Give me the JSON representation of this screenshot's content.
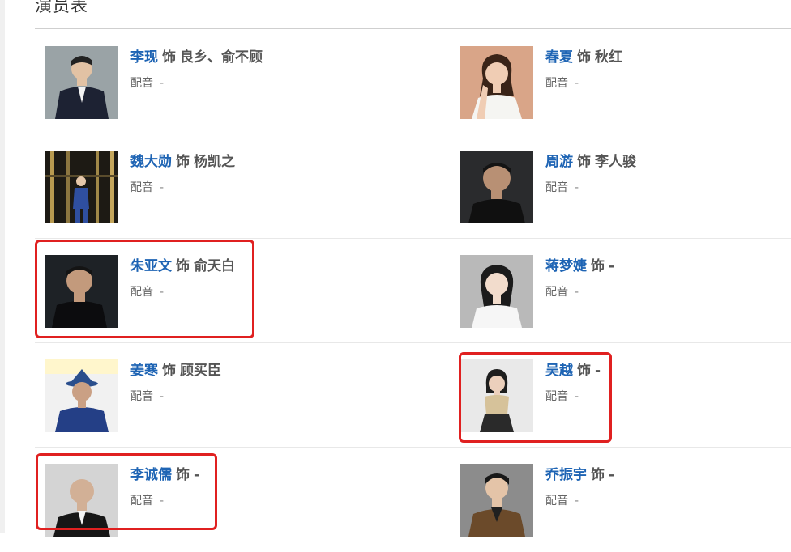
{
  "section": {
    "title": "演员表"
  },
  "cast": [
    {
      "actor": "李现",
      "role_prefix": "饰",
      "role": "良乡、俞不顾",
      "voice_label": "配音",
      "voice_value": "-"
    },
    {
      "actor": "春夏",
      "role_prefix": "饰",
      "role": "秋红",
      "voice_label": "配音",
      "voice_value": "-"
    },
    {
      "actor": "魏大勋",
      "role_prefix": "饰",
      "role": "杨凯之",
      "voice_label": "配音",
      "voice_value": "-"
    },
    {
      "actor": "周游",
      "role_prefix": "饰",
      "role": "李人骏",
      "voice_label": "配音",
      "voice_value": "-"
    },
    {
      "actor": "朱亚文",
      "role_prefix": "饰",
      "role": "俞天白",
      "voice_label": "配音",
      "voice_value": "-"
    },
    {
      "actor": "蒋梦婕",
      "role_prefix": "饰",
      "role": "-",
      "voice_label": "配音",
      "voice_value": "-"
    },
    {
      "actor": "姜寒",
      "role_prefix": "饰",
      "role": "顾买臣",
      "voice_label": "配音",
      "voice_value": "-"
    },
    {
      "actor": "吴越",
      "role_prefix": "饰",
      "role": "-",
      "voice_label": "配音",
      "voice_value": "-"
    },
    {
      "actor": "李诚儒",
      "role_prefix": "饰",
      "role": "-",
      "voice_label": "配音",
      "voice_value": "-"
    },
    {
      "actor": "乔振宇",
      "role_prefix": "饰",
      "role": "-",
      "voice_label": "配音",
      "voice_value": "-"
    }
  ],
  "colors": {
    "actor_link": "#1e64b4",
    "highlight": "#e02020",
    "divider": "#e8e8e8"
  }
}
